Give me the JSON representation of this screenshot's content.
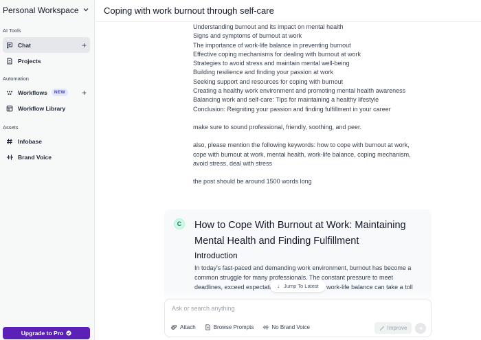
{
  "sidebar": {
    "workspace": "Personal Workspace",
    "sections": {
      "ai_tools": "AI Tools",
      "automation": "Automation",
      "assets": "Assets"
    },
    "items": {
      "chat": "Chat",
      "projects": "Projects",
      "workflows": "Workflows",
      "workflows_badge": "NEW",
      "workflow_library": "Workflow Library",
      "infobase": "Infobase",
      "brand_voice": "Brand Voice"
    },
    "upgrade": "Upgrade to Pro"
  },
  "header": {
    "title": "Coping with work burnout through self-care"
  },
  "user_message": {
    "outline": [
      "Understanding burnout and its impact on mental health",
      "Signs and symptoms of burnout at work",
      "The importance of work-life balance in preventing burnout",
      "Effective coping mechanisms for dealing with burnout at work",
      "Strategies to avoid stress and maintain mental well-being",
      "Building resilience and finding your passion at work",
      "Seeking support and resources for coping with burnout",
      "Creating a healthy work environment and promoting mental health awareness",
      "Balancing work and self-care: Tips for maintaining a healthy lifestyle",
      "Conclusion: Reigniting your passion and finding fulfillment in your career"
    ],
    "tone": "make sure to sound professional, friendly, soothing, and peer.",
    "keywords": "also, please mention the following keywords: how to cope with burnout at work, cope with burnout at work, mental health, work-life balance, coping mechanism, avoid stress, deal with stress",
    "length": "the post should be around 1500 words long"
  },
  "response": {
    "avatar": "C",
    "title": "How to Cope With Burnout at Work: Maintaining Mental Health and Finding Fulfillment",
    "heading": "Introduction",
    "body": "In today's fast-paced and demanding work environment, burnout has become a common struggle for many professionals. The constant pressure to meet deadlines, exceed expectations, and maintain a work-life balance can take a toll"
  },
  "jump": "Jump To Latest",
  "composer": {
    "placeholder": "Ask or search anything",
    "attach": "Attach",
    "browse": "Browse Prompts",
    "brand_voice": "No Brand Voice",
    "improve": "Improve"
  }
}
